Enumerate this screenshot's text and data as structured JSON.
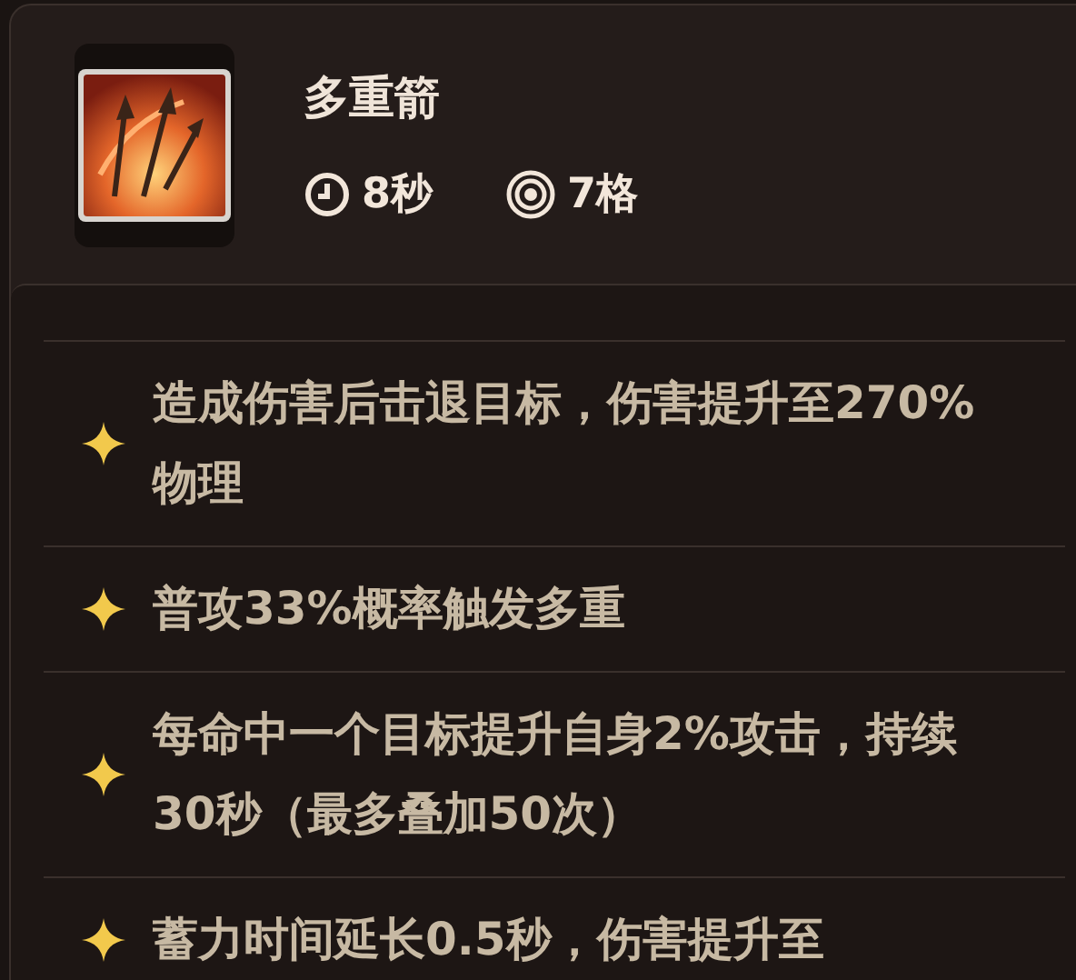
{
  "skill": {
    "name": "多重箭",
    "stats": [
      {
        "kind": "cooldown",
        "text": "8秒"
      },
      {
        "kind": "range",
        "text": "7格"
      }
    ]
  },
  "effects": [
    "造成伤害后击退目标，伤害提升至270%物理",
    "普攻33%概率触发多重",
    "每命中一个目标提升自身2%攻击，持续30秒（最多叠加50次）",
    "蓄力时间延长0.5秒，伤害提升至"
  ]
}
